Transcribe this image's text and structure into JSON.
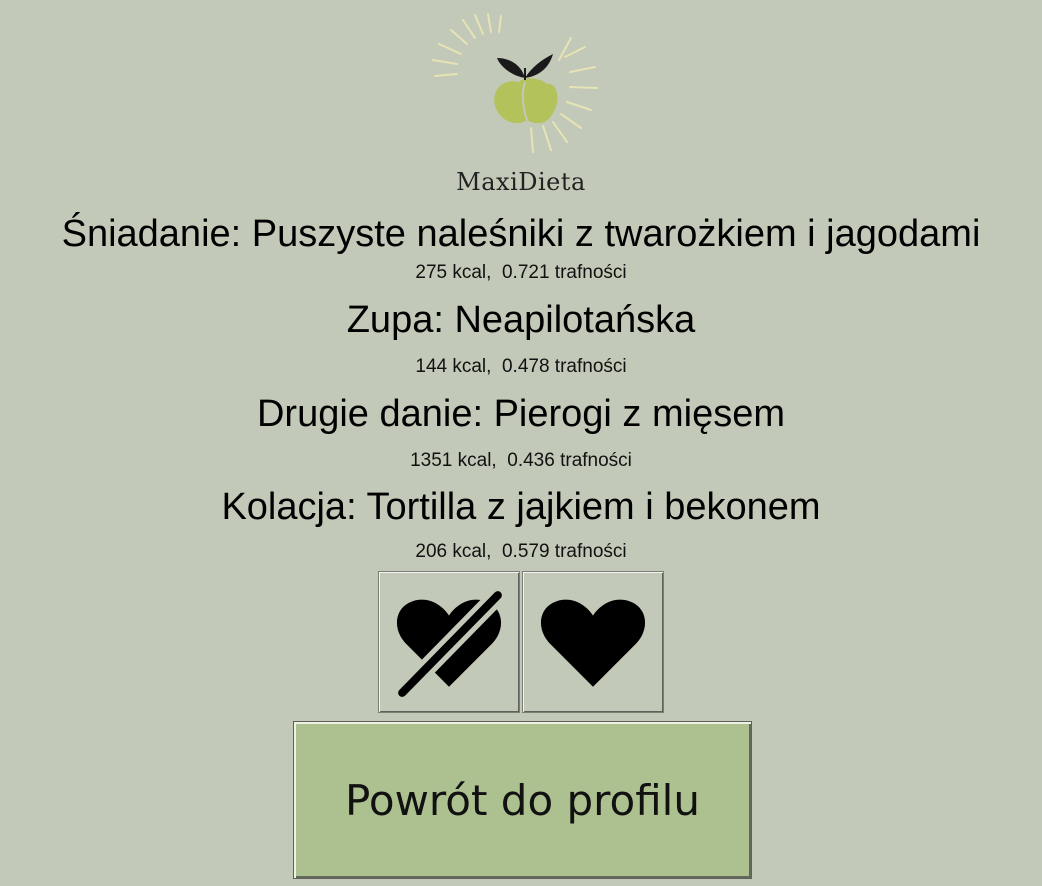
{
  "app": {
    "brand": "MaxiDieta"
  },
  "meals": [
    {
      "title": "Śniadanie: Puszyste naleśniki z twarożkiem i jagodami",
      "info": "275 kcal,  0.721 trafności"
    },
    {
      "title": "Zupa: Neapilotańska",
      "info": "144 kcal,  0.478 trafności"
    },
    {
      "title": "Drugie danie: Pierogi z mięsem",
      "info": "1351 kcal,  0.436 trafności"
    },
    {
      "title": "Kolacja: Tortilla z jajkiem i bekonem",
      "info": "206 kcal,  0.579 trafności"
    }
  ],
  "actions": {
    "dislike_icon": "heart-crossed-icon",
    "like_icon": "heart-icon",
    "back_label": "Powrót do profilu"
  },
  "colors": {
    "background": "#c3c9b8",
    "button_green": "#adc090",
    "logo_green": "#b3c25a",
    "leaf_dark": "#1a1a1a"
  }
}
